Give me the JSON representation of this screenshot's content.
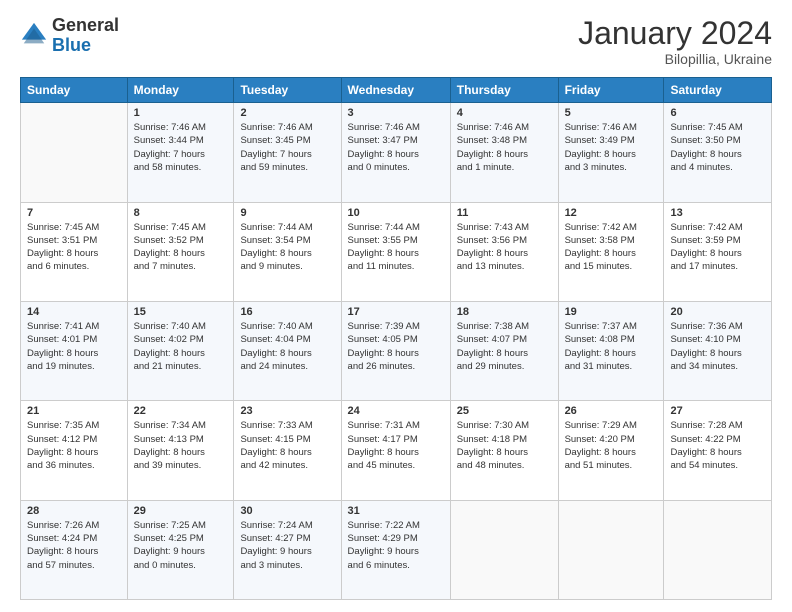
{
  "logo": {
    "general": "General",
    "blue": "Blue"
  },
  "header": {
    "month": "January 2024",
    "location": "Bilopillia, Ukraine"
  },
  "columns": [
    "Sunday",
    "Monday",
    "Tuesday",
    "Wednesday",
    "Thursday",
    "Friday",
    "Saturday"
  ],
  "weeks": [
    [
      {
        "day": "",
        "info": ""
      },
      {
        "day": "1",
        "info": "Sunrise: 7:46 AM\nSunset: 3:44 PM\nDaylight: 7 hours\nand 58 minutes."
      },
      {
        "day": "2",
        "info": "Sunrise: 7:46 AM\nSunset: 3:45 PM\nDaylight: 7 hours\nand 59 minutes."
      },
      {
        "day": "3",
        "info": "Sunrise: 7:46 AM\nSunset: 3:47 PM\nDaylight: 8 hours\nand 0 minutes."
      },
      {
        "day": "4",
        "info": "Sunrise: 7:46 AM\nSunset: 3:48 PM\nDaylight: 8 hours\nand 1 minute."
      },
      {
        "day": "5",
        "info": "Sunrise: 7:46 AM\nSunset: 3:49 PM\nDaylight: 8 hours\nand 3 minutes."
      },
      {
        "day": "6",
        "info": "Sunrise: 7:45 AM\nSunset: 3:50 PM\nDaylight: 8 hours\nand 4 minutes."
      }
    ],
    [
      {
        "day": "7",
        "info": "Sunrise: 7:45 AM\nSunset: 3:51 PM\nDaylight: 8 hours\nand 6 minutes."
      },
      {
        "day": "8",
        "info": "Sunrise: 7:45 AM\nSunset: 3:52 PM\nDaylight: 8 hours\nand 7 minutes."
      },
      {
        "day": "9",
        "info": "Sunrise: 7:44 AM\nSunset: 3:54 PM\nDaylight: 8 hours\nand 9 minutes."
      },
      {
        "day": "10",
        "info": "Sunrise: 7:44 AM\nSunset: 3:55 PM\nDaylight: 8 hours\nand 11 minutes."
      },
      {
        "day": "11",
        "info": "Sunrise: 7:43 AM\nSunset: 3:56 PM\nDaylight: 8 hours\nand 13 minutes."
      },
      {
        "day": "12",
        "info": "Sunrise: 7:42 AM\nSunset: 3:58 PM\nDaylight: 8 hours\nand 15 minutes."
      },
      {
        "day": "13",
        "info": "Sunrise: 7:42 AM\nSunset: 3:59 PM\nDaylight: 8 hours\nand 17 minutes."
      }
    ],
    [
      {
        "day": "14",
        "info": "Sunrise: 7:41 AM\nSunset: 4:01 PM\nDaylight: 8 hours\nand 19 minutes."
      },
      {
        "day": "15",
        "info": "Sunrise: 7:40 AM\nSunset: 4:02 PM\nDaylight: 8 hours\nand 21 minutes."
      },
      {
        "day": "16",
        "info": "Sunrise: 7:40 AM\nSunset: 4:04 PM\nDaylight: 8 hours\nand 24 minutes."
      },
      {
        "day": "17",
        "info": "Sunrise: 7:39 AM\nSunset: 4:05 PM\nDaylight: 8 hours\nand 26 minutes."
      },
      {
        "day": "18",
        "info": "Sunrise: 7:38 AM\nSunset: 4:07 PM\nDaylight: 8 hours\nand 29 minutes."
      },
      {
        "day": "19",
        "info": "Sunrise: 7:37 AM\nSunset: 4:08 PM\nDaylight: 8 hours\nand 31 minutes."
      },
      {
        "day": "20",
        "info": "Sunrise: 7:36 AM\nSunset: 4:10 PM\nDaylight: 8 hours\nand 34 minutes."
      }
    ],
    [
      {
        "day": "21",
        "info": "Sunrise: 7:35 AM\nSunset: 4:12 PM\nDaylight: 8 hours\nand 36 minutes."
      },
      {
        "day": "22",
        "info": "Sunrise: 7:34 AM\nSunset: 4:13 PM\nDaylight: 8 hours\nand 39 minutes."
      },
      {
        "day": "23",
        "info": "Sunrise: 7:33 AM\nSunset: 4:15 PM\nDaylight: 8 hours\nand 42 minutes."
      },
      {
        "day": "24",
        "info": "Sunrise: 7:31 AM\nSunset: 4:17 PM\nDaylight: 8 hours\nand 45 minutes."
      },
      {
        "day": "25",
        "info": "Sunrise: 7:30 AM\nSunset: 4:18 PM\nDaylight: 8 hours\nand 48 minutes."
      },
      {
        "day": "26",
        "info": "Sunrise: 7:29 AM\nSunset: 4:20 PM\nDaylight: 8 hours\nand 51 minutes."
      },
      {
        "day": "27",
        "info": "Sunrise: 7:28 AM\nSunset: 4:22 PM\nDaylight: 8 hours\nand 54 minutes."
      }
    ],
    [
      {
        "day": "28",
        "info": "Sunrise: 7:26 AM\nSunset: 4:24 PM\nDaylight: 8 hours\nand 57 minutes."
      },
      {
        "day": "29",
        "info": "Sunrise: 7:25 AM\nSunset: 4:25 PM\nDaylight: 9 hours\nand 0 minutes."
      },
      {
        "day": "30",
        "info": "Sunrise: 7:24 AM\nSunset: 4:27 PM\nDaylight: 9 hours\nand 3 minutes."
      },
      {
        "day": "31",
        "info": "Sunrise: 7:22 AM\nSunset: 4:29 PM\nDaylight: 9 hours\nand 6 minutes."
      },
      {
        "day": "",
        "info": ""
      },
      {
        "day": "",
        "info": ""
      },
      {
        "day": "",
        "info": ""
      }
    ]
  ]
}
